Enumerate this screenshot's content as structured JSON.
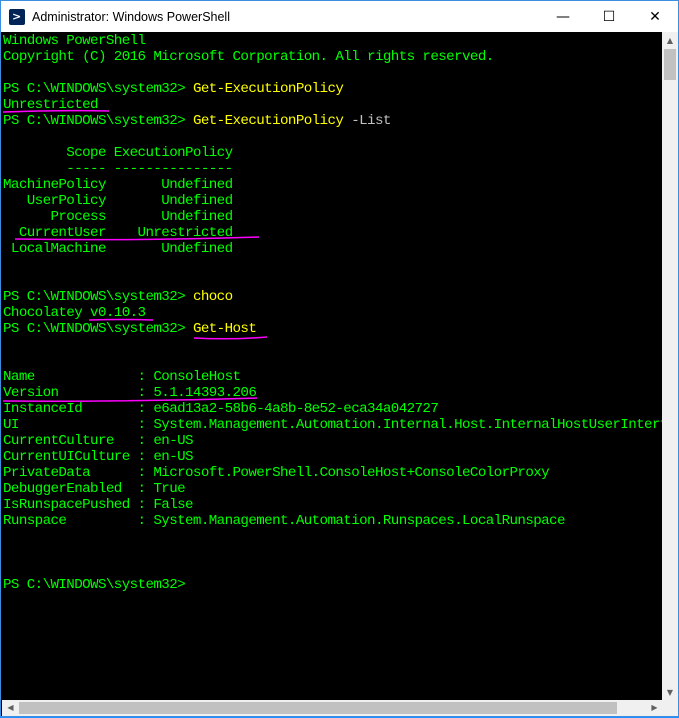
{
  "window": {
    "title": "Administrator: Windows PowerShell",
    "icon_glyph": ">",
    "minimize": "—",
    "maximize": "☐",
    "close": "✕"
  },
  "console": {
    "lines": [
      {
        "text": "Windows PowerShell",
        "color": "g"
      },
      {
        "text": "Copyright (C) 2016 Microsoft Corporation. All rights reserved.",
        "color": "g"
      },
      {
        "text": "",
        "color": "g"
      },
      {
        "prompt": "PS C:\\WINDOWS\\system32> ",
        "cmd": "Get-ExecutionPolicy"
      },
      {
        "text": "Unrestricted",
        "color": "g"
      },
      {
        "prompt": "PS C:\\WINDOWS\\system32> ",
        "cmd": "Get-ExecutionPolicy",
        "param": " -List"
      },
      {
        "text": "",
        "color": "g"
      },
      {
        "text": "        Scope ExecutionPolicy",
        "color": "g"
      },
      {
        "text": "        ----- ---------------",
        "color": "g"
      },
      {
        "text": "MachinePolicy       Undefined",
        "color": "g"
      },
      {
        "text": "   UserPolicy       Undefined",
        "color": "g"
      },
      {
        "text": "      Process       Undefined",
        "color": "g"
      },
      {
        "text": "  CurrentUser    Unrestricted",
        "color": "g"
      },
      {
        "text": " LocalMachine       Undefined",
        "color": "g"
      },
      {
        "text": "",
        "color": "g"
      },
      {
        "text": "",
        "color": "g"
      },
      {
        "prompt": "PS C:\\WINDOWS\\system32> ",
        "cmd": "choco"
      },
      {
        "text": "Chocolatey v0.10.3",
        "color": "g"
      },
      {
        "prompt": "PS C:\\WINDOWS\\system32> ",
        "cmd": "Get-Host"
      },
      {
        "text": "",
        "color": "g"
      },
      {
        "text": "",
        "color": "g"
      },
      {
        "text": "Name             : ConsoleHost",
        "color": "g"
      },
      {
        "text": "Version          : 5.1.14393.206",
        "color": "g"
      },
      {
        "text": "InstanceId       : e6ad13a2-58b6-4a8b-8e52-eca34a042727",
        "color": "g"
      },
      {
        "text": "UI               : System.Management.Automation.Internal.Host.InternalHostUserInterface",
        "color": "g"
      },
      {
        "text": "CurrentCulture   : en-US",
        "color": "g"
      },
      {
        "text": "CurrentUICulture : en-US",
        "color": "g"
      },
      {
        "text": "PrivateData      : Microsoft.PowerShell.ConsoleHost+ConsoleColorProxy",
        "color": "g"
      },
      {
        "text": "DebuggerEnabled  : True",
        "color": "g"
      },
      {
        "text": "IsRunspacePushed : False",
        "color": "g"
      },
      {
        "text": "Runspace         : System.Management.Automation.Runspaces.LocalRunspace",
        "color": "g"
      },
      {
        "text": "",
        "color": "g"
      },
      {
        "text": "",
        "color": "g"
      },
      {
        "text": "",
        "color": "g"
      },
      {
        "prompt": "PS C:\\WINDOWS\\system32> ",
        "cmd": ""
      }
    ]
  },
  "colors": {
    "text": "#00ff00",
    "command": "#ffff00",
    "parameter": "#c0c0c0",
    "annotation": "#ff00ff",
    "background": "#000000"
  }
}
